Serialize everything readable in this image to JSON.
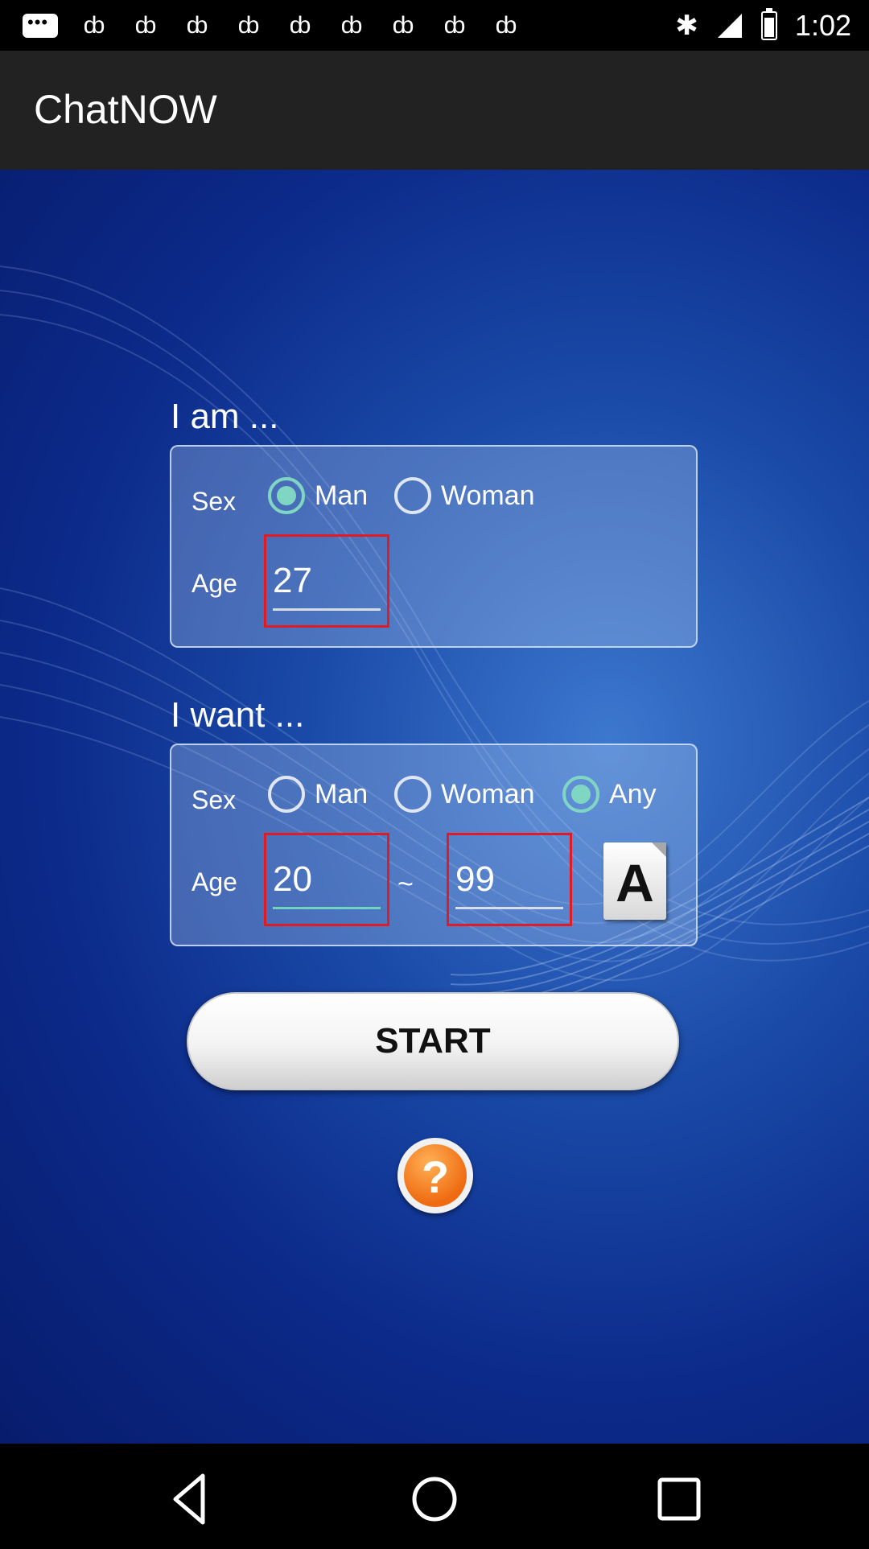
{
  "status_bar": {
    "time": "1:02",
    "notification_icons": [
      "message-icon",
      "app-icon",
      "app-icon",
      "app-icon",
      "app-icon",
      "app-icon",
      "app-icon",
      "app-icon",
      "app-icon",
      "app-icon",
      "app-icon"
    ],
    "right_icons": [
      "bluetooth-icon",
      "signal-icon",
      "battery-icon"
    ]
  },
  "app_bar": {
    "title": "ChatNOW"
  },
  "i_am": {
    "heading": "I am ...",
    "sex_label": "Sex",
    "options": [
      {
        "label": "Man",
        "selected": true
      },
      {
        "label": "Woman",
        "selected": false
      }
    ],
    "age_label": "Age",
    "age_value": "27"
  },
  "i_want": {
    "heading": "I want ...",
    "sex_label": "Sex",
    "options": [
      {
        "label": "Man",
        "selected": false
      },
      {
        "label": "Woman",
        "selected": false
      },
      {
        "label": "Any",
        "selected": true
      }
    ],
    "age_label": "Age",
    "age_min": "20",
    "separator": "~",
    "age_max": "99",
    "font_icon_letter": "A"
  },
  "start_button": "START",
  "help_symbol": "?",
  "colors": {
    "accent": "#7fd6c3",
    "highlight_box": "#e01b24",
    "help": "#ef6a10"
  }
}
